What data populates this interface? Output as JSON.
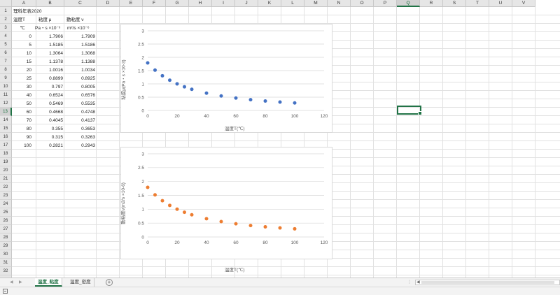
{
  "columns": [
    "A",
    "B",
    "C",
    "D",
    "E",
    "F",
    "G",
    "H",
    "I",
    "J",
    "K",
    "L",
    "M",
    "N",
    "O",
    "P",
    "Q",
    "R",
    "S",
    "T",
    "U",
    "V"
  ],
  "selected_column": "Q",
  "selected_row": 13,
  "rows_visible": 33,
  "cells": {
    "A1": "理科年表2020",
    "A2": "温度T",
    "B2": "粘度 μ",
    "C2": "動粘度 ν",
    "A3": "℃",
    "B3": "Pa・s ×10⁻³",
    "C3": "m²/s ×10⁻⁶"
  },
  "table": {
    "temperature": [
      "0",
      "5",
      "10",
      "15",
      "20",
      "25",
      "30",
      "40",
      "50",
      "60",
      "70",
      "80",
      "90",
      "100"
    ],
    "viscosity": [
      "1.7906",
      "1.5185",
      "1.3064",
      "1.1378",
      "1.0016",
      "0.8899",
      "0.797",
      "0.6524",
      "0.5469",
      "0.4668",
      "0.4045",
      "0.355",
      "0.315",
      "0.2821"
    ],
    "kinematic_viscosity": [
      "1.7909",
      "1.5186",
      "1.3068",
      "1.1388",
      "1.0034",
      "0.8925",
      "0.8005",
      "0.6576",
      "0.5535",
      "0.4748",
      "0.4137",
      "0.3653",
      "0.3263",
      "0.2943"
    ]
  },
  "chart_data": [
    {
      "type": "scatter",
      "ylabel": "粘度μ(Pa・s ×10-3)",
      "xlabel": "温度T(℃)",
      "x": [
        0,
        5,
        10,
        15,
        20,
        25,
        30,
        40,
        50,
        60,
        70,
        80,
        90,
        100
      ],
      "y": [
        1.7906,
        1.5185,
        1.3064,
        1.1378,
        1.0016,
        0.8899,
        0.797,
        0.6524,
        0.5469,
        0.4668,
        0.4045,
        0.355,
        0.315,
        0.2821
      ],
      "xlim": [
        0,
        120
      ],
      "ylim": [
        0,
        3
      ],
      "xticks": [
        0,
        20,
        40,
        60,
        80,
        100,
        120
      ],
      "yticks": [
        0,
        0.5,
        1,
        1.5,
        2,
        2.5,
        3
      ],
      "ytick_labels": [
        "0",
        "0.5",
        "1",
        "1.5",
        "2",
        "2.5",
        "3"
      ],
      "grid": true,
      "color": "#4472c4"
    },
    {
      "type": "scatter",
      "ylabel": "動粘度ν(m2/s ×10-6)",
      "xlabel": "温度T(℃)",
      "x": [
        0,
        5,
        10,
        15,
        20,
        25,
        30,
        40,
        50,
        60,
        70,
        80,
        90,
        100
      ],
      "y": [
        1.7909,
        1.5186,
        1.3068,
        1.1388,
        1.0034,
        0.8925,
        0.8005,
        0.6576,
        0.5535,
        0.4748,
        0.4137,
        0.3653,
        0.3263,
        0.2943
      ],
      "xlim": [
        0,
        120
      ],
      "ylim": [
        0,
        3
      ],
      "xticks": [
        0,
        20,
        40,
        60,
        80,
        100,
        120
      ],
      "yticks": [
        0,
        0.5,
        1,
        1.5,
        2,
        2.5,
        3
      ],
      "ytick_labels": [
        "0",
        "0.5",
        "1",
        "1.5",
        "2",
        "2.5",
        "3"
      ],
      "grid": true,
      "color": "#ed7d31"
    }
  ],
  "tabs": [
    {
      "label": "温度_粘度",
      "active": true
    },
    {
      "label": "温度_密度",
      "active": false
    }
  ],
  "add_sheet_label": "+",
  "nav_prev": "◀",
  "nav_next": "▶",
  "scroll_more": "⋮",
  "colors": {
    "excel_green": "#217346",
    "series1": "#4472c4",
    "series2": "#ed7d31"
  }
}
